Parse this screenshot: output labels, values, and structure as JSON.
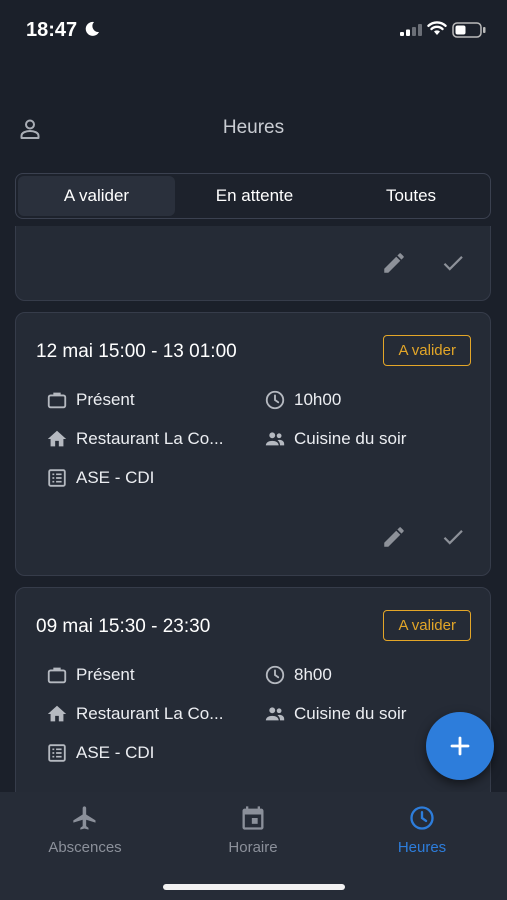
{
  "status": {
    "time": "18:47"
  },
  "header": {
    "title": "Heures"
  },
  "tabs": [
    {
      "label": "A valider"
    },
    {
      "label": "En attente"
    },
    {
      "label": "Toutes"
    }
  ],
  "cards": [
    {
      "title": "12 mai 15:00 - 13 01:00",
      "badge": "A valider",
      "status": "Présent",
      "duration": "10h00",
      "location": "Restaurant La Co...",
      "team": "Cuisine du soir",
      "contract": "ASE - CDI"
    },
    {
      "title": "09 mai 15:30 - 23:30",
      "badge": "A valider",
      "status": "Présent",
      "duration": "8h00",
      "location": "Restaurant La Co...",
      "team": "Cuisine du soir",
      "contract": "ASE - CDI"
    }
  ],
  "nav": [
    {
      "label": "Abscences",
      "icon": "airplane-icon"
    },
    {
      "label": "Horaire",
      "icon": "calendar-icon"
    },
    {
      "label": "Heures",
      "icon": "clock-icon"
    }
  ],
  "colors": {
    "accent": "#2d7ddb",
    "badge": "#e3a628",
    "background": "#1b202a",
    "card": "#252b36"
  }
}
